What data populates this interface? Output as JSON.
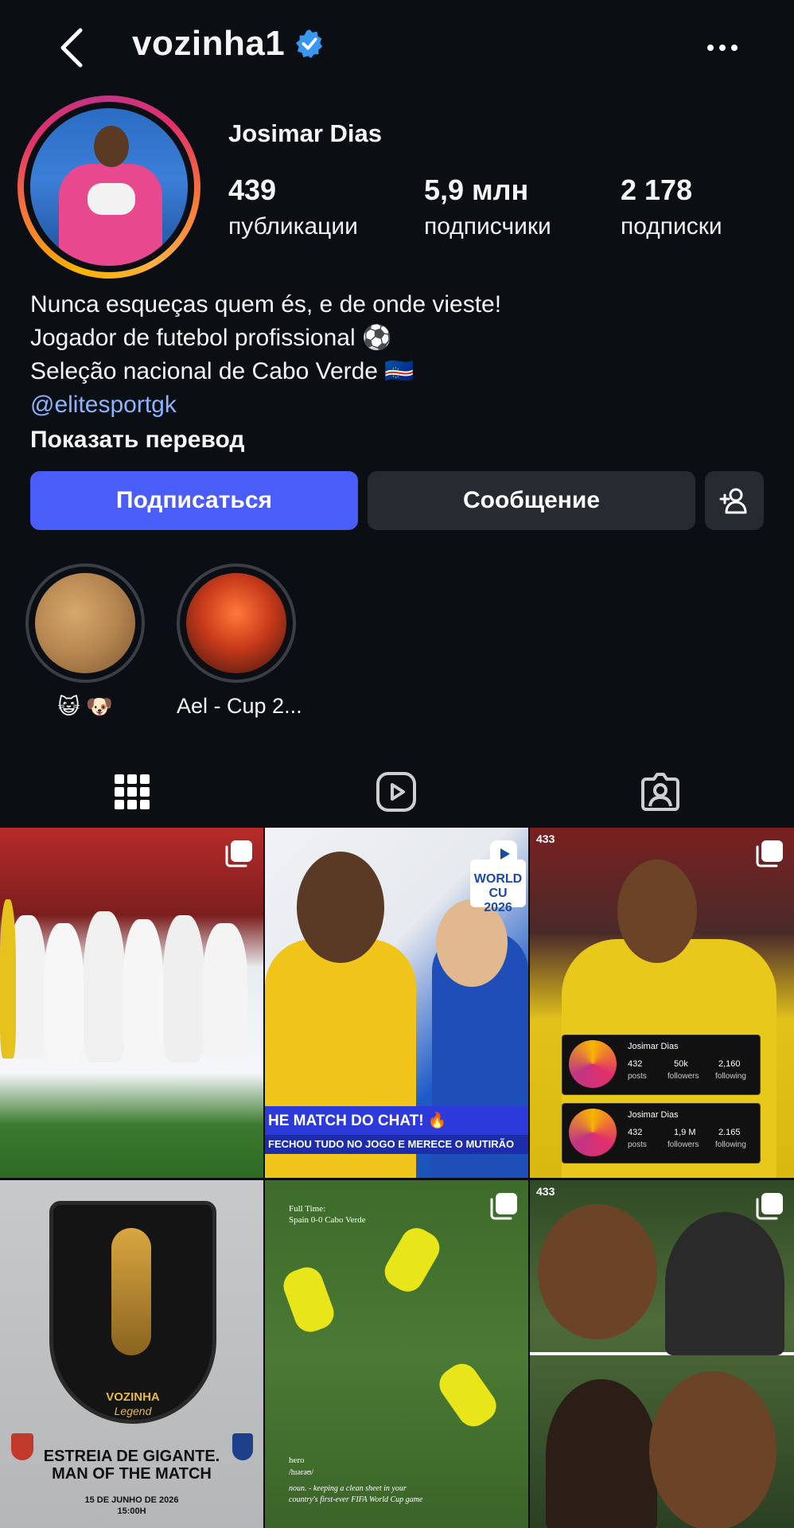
{
  "header": {
    "username": "vozinha1",
    "back_icon": "chevron-left-icon",
    "verified_icon": "verified-badge-icon",
    "more_icon": "more-horizontal-icon"
  },
  "profile": {
    "display_name": "Josimar Dias",
    "stats": [
      {
        "value": "439",
        "label": "публикации"
      },
      {
        "value": "5,9 млн",
        "label": "подписчики"
      },
      {
        "value": "2 178",
        "label": "подписки"
      }
    ],
    "bio": {
      "line1": "Nunca esqueças quem és, e de onde vieste!",
      "line2": "Jogador de futebol profissional ⚽",
      "line3": "Seleção nacional de Cabo Verde 🇨🇻",
      "link": "@elitesportgk",
      "translate": "Показать перевод"
    }
  },
  "actions": {
    "follow": "Подписаться",
    "message": "Сообщение",
    "add_user_icon": "add-user-icon"
  },
  "highlights": [
    {
      "label": "😺 🐶"
    },
    {
      "label": "Ael - Cup 2..."
    }
  ],
  "tabs": [
    {
      "name": "posts-grid",
      "icon": "grid-icon",
      "active": true
    },
    {
      "name": "reels",
      "icon": "reels-icon",
      "active": false
    },
    {
      "name": "tagged",
      "icon": "tagged-user-icon",
      "active": false
    }
  ],
  "posts": {
    "p2": {
      "banner": "HE MATCH DO CHAT! 🔥",
      "sub": "FECHOU TUDO NO JOGO E MERECE O MUTIRÃO",
      "badge_line1": "WORLD CU",
      "badge_line2": "2026"
    },
    "p3": {
      "card1": {
        "name": "Josimar Dias",
        "posts": "432",
        "posts_label": "posts",
        "followers": "50k",
        "followers_label": "followers",
        "following": "2,160",
        "following_label": "following"
      },
      "card2": {
        "name": "Josimar Dias",
        "posts": "432",
        "posts_label": "posts",
        "followers": "1,9 M",
        "followers_label": "followers",
        "following": "2.165",
        "following_label": "following"
      },
      "watermark": "433"
    },
    "p4": {
      "legend_name": "VOZINHA",
      "legend_sub": "Legend",
      "headline1": "ESTREIA DE GIGANTE.",
      "headline2": "MAN OF THE MATCH",
      "date": "15 DE JUNHO DE 2026",
      "time": "15:00H"
    },
    "p5": {
      "fulltime": "Full Time:",
      "score": "Spain 0-0 Cabo Verde",
      "word": "hero",
      "phonetic": "/hɪərəʊ/",
      "definition1": "noun. - keeping a clean sheet in your",
      "definition2": "country's first-ever FIFA World Cup game"
    },
    "p6": {
      "watermark": "433"
    }
  }
}
